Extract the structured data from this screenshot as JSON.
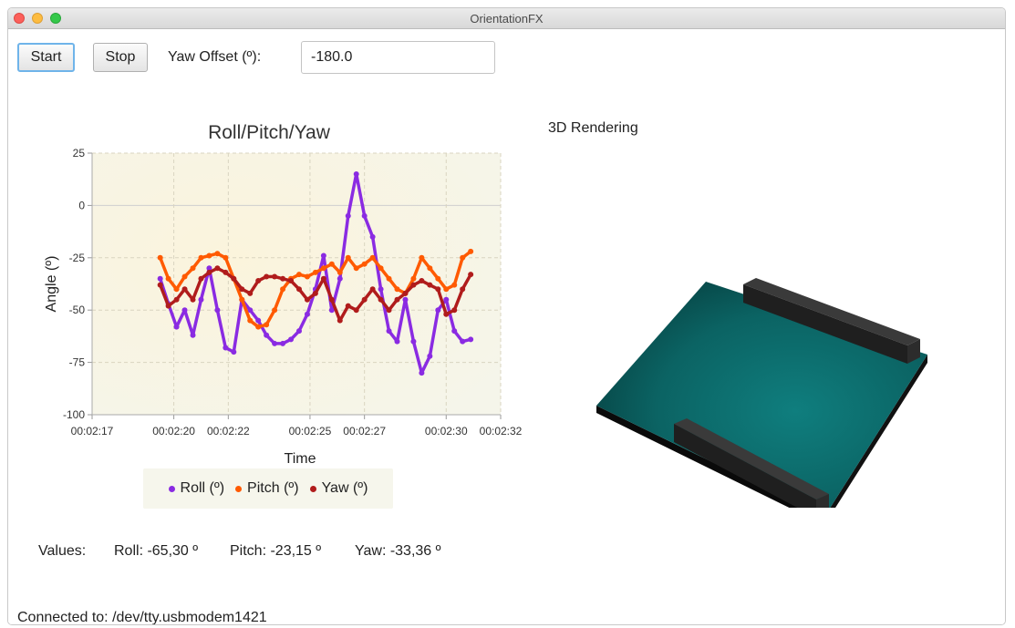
{
  "window": {
    "title": "OrientationFX"
  },
  "toolbar": {
    "start_label": "Start",
    "stop_label": "Stop",
    "yaw_offset_label": "Yaw Offset (º):",
    "yaw_offset_value": "-180.0"
  },
  "chart_data": {
    "type": "line",
    "title": "Roll/Pitch/Yaw",
    "xlabel": "Time",
    "ylabel": "Angle (º)",
    "ylim": [
      -100,
      25
    ],
    "xlim": [
      137,
      152
    ],
    "yticks": [
      25,
      0,
      -25,
      -50,
      -75,
      -100
    ],
    "xticks": [
      137,
      140,
      142,
      145,
      147,
      150,
      152
    ],
    "xtick_labels": [
      "00:02:17",
      "00:02:20",
      "00:02:22",
      "00:02:25",
      "00:02:27",
      "00:02:30",
      "00:02:32"
    ],
    "grid": true,
    "legend": "bottom",
    "series": [
      {
        "name": "Roll (º)",
        "color": "#8a2be2",
        "x": [
          139.5,
          139.8,
          140.1,
          140.4,
          140.7,
          141.0,
          141.3,
          141.6,
          141.9,
          142.2,
          142.5,
          142.8,
          143.1,
          143.4,
          143.7,
          144.0,
          144.3,
          144.6,
          144.9,
          145.2,
          145.5,
          145.8,
          146.1,
          146.4,
          146.7,
          147.0,
          147.3,
          147.6,
          147.9,
          148.2,
          148.5,
          148.8,
          149.1,
          149.4,
          149.7,
          150.0,
          150.3,
          150.6,
          150.9
        ],
        "y": [
          -35,
          -47,
          -58,
          -50,
          -62,
          -45,
          -30,
          -50,
          -68,
          -70,
          -45,
          -50,
          -55,
          -62,
          -66,
          -66,
          -64,
          -60,
          -52,
          -40,
          -24,
          -50,
          -35,
          -5,
          15,
          -5,
          -15,
          -40,
          -60,
          -65,
          -45,
          -65,
          -80,
          -72,
          -50,
          -45,
          -60,
          -65,
          -64
        ]
      },
      {
        "name": "Pitch (º)",
        "color": "#ff5a00",
        "x": [
          139.5,
          139.8,
          140.1,
          140.4,
          140.7,
          141.0,
          141.3,
          141.6,
          141.9,
          142.2,
          142.5,
          142.8,
          143.1,
          143.4,
          143.7,
          144.0,
          144.3,
          144.6,
          144.9,
          145.2,
          145.5,
          145.8,
          146.1,
          146.4,
          146.7,
          147.0,
          147.3,
          147.6,
          147.9,
          148.2,
          148.5,
          148.8,
          149.1,
          149.4,
          149.7,
          150.0,
          150.3,
          150.6,
          150.9
        ],
        "y": [
          -25,
          -35,
          -40,
          -34,
          -30,
          -25,
          -24,
          -23,
          -25,
          -35,
          -45,
          -55,
          -58,
          -57,
          -50,
          -40,
          -35,
          -33,
          -34,
          -32,
          -30,
          -28,
          -32,
          -25,
          -30,
          -28,
          -25,
          -30,
          -35,
          -40,
          -42,
          -35,
          -25,
          -30,
          -35,
          -40,
          -38,
          -25,
          -22
        ]
      },
      {
        "name": "Yaw (º)",
        "color": "#b01c1c",
        "x": [
          139.5,
          139.8,
          140.1,
          140.4,
          140.7,
          141.0,
          141.3,
          141.6,
          141.9,
          142.2,
          142.5,
          142.8,
          143.1,
          143.4,
          143.7,
          144.0,
          144.3,
          144.6,
          144.9,
          145.2,
          145.5,
          145.8,
          146.1,
          146.4,
          146.7,
          147.0,
          147.3,
          147.6,
          147.9,
          148.2,
          148.5,
          148.8,
          149.1,
          149.4,
          149.7,
          150.0,
          150.3,
          150.6,
          150.9
        ],
        "y": [
          -38,
          -48,
          -45,
          -40,
          -45,
          -35,
          -32,
          -30,
          -32,
          -35,
          -40,
          -42,
          -36,
          -34,
          -34,
          -35,
          -36,
          -40,
          -45,
          -42,
          -35,
          -45,
          -55,
          -48,
          -50,
          -45,
          -40,
          -45,
          -50,
          -45,
          -42,
          -38,
          -36,
          -38,
          -40,
          -52,
          -50,
          -40,
          -33
        ]
      }
    ]
  },
  "values": {
    "label": "Values:",
    "roll": "Roll: -65,30 º",
    "pitch": "Pitch: -23,15 º",
    "yaw": "Yaw: -33,36 º"
  },
  "render": {
    "title": "3D Rendering",
    "board_color": "#0e6b6b",
    "rail_color": "#2b2b2b"
  },
  "status": {
    "text": "Connected to: /dev/tty.usbmodem1421"
  }
}
